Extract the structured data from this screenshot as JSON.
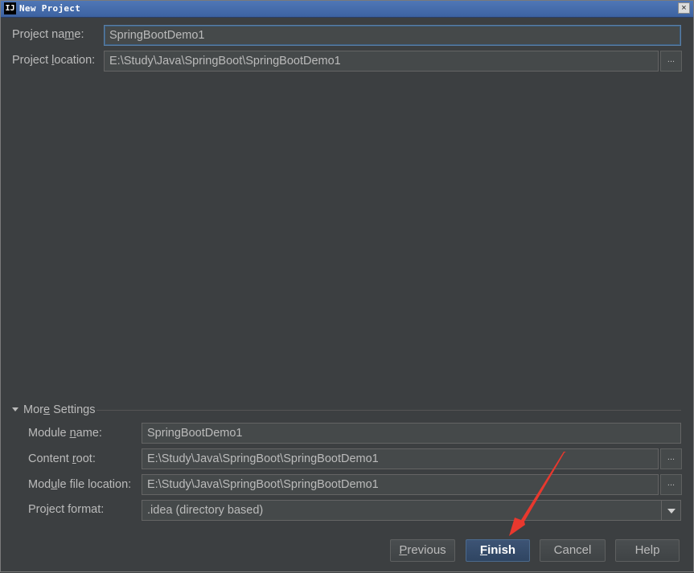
{
  "window": {
    "app_icon": "IJ",
    "title": "New Project",
    "close_label": "×"
  },
  "project": {
    "name_label_pre": "Project na",
    "name_label_mn": "m",
    "name_label_post": "e:",
    "name_value": "SpringBootDemo1",
    "location_label_pre": "Project ",
    "location_label_mn": "l",
    "location_label_post": "ocation:",
    "location_value": "E:\\Study\\Java\\SpringBoot\\SpringBootDemo1",
    "browse_label": "..."
  },
  "more_settings": {
    "toggle_pre": "Mor",
    "toggle_mn": "e",
    "toggle_post": " Settings",
    "expanded": true,
    "module_name_label_pre": "Module ",
    "module_name_label_mn": "n",
    "module_name_label_post": "ame:",
    "module_name_value": "SpringBootDemo1",
    "content_root_label_pre": "Content ",
    "content_root_label_mn": "r",
    "content_root_label_post": "oot:",
    "content_root_value": "E:\\Study\\Java\\SpringBoot\\SpringBootDemo1",
    "module_file_label_pre": "Mod",
    "module_file_label_mn": "u",
    "module_file_label_post": "le file location:",
    "module_file_value": "E:\\Study\\Java\\SpringBoot\\SpringBootDemo1",
    "project_format_label": "Project format:",
    "project_format_value": ".idea (directory based)",
    "browse_label": "..."
  },
  "buttons": {
    "previous_mn": "P",
    "previous_rest": "revious",
    "finish_mn": "F",
    "finish_rest": "inish",
    "cancel": "Cancel",
    "help": "Help"
  },
  "annotation": {
    "arrow_color": "#e8382e"
  },
  "colors": {
    "background": "#3c3f41",
    "field_bg": "#45494a",
    "text": "#bbbbbb",
    "title_bar": "#3d62a1",
    "primary_button": "#2f4562"
  }
}
